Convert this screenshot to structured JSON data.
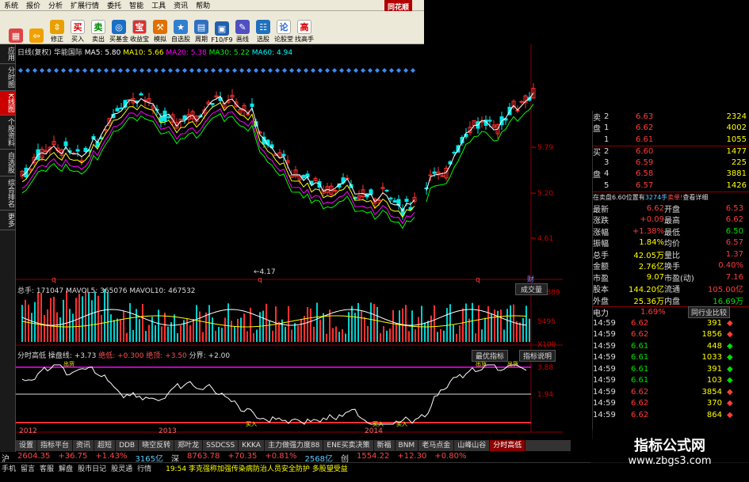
{
  "menu": [
    "系统",
    "报价",
    "分析",
    "扩展行情",
    "委托",
    "智能",
    "工具",
    "资讯",
    "帮助"
  ],
  "logo": "同花顺",
  "toolbar": [
    {
      "label": "",
      "icon": "grid-icon",
      "color": "#d44"
    },
    {
      "label": "",
      "icon": "back-arrow-icon",
      "color": "#f0a000"
    },
    {
      "label": "修正",
      "icon": "up-down-icon",
      "color": "#e8a000"
    },
    {
      "label": "买入",
      "text": "买",
      "color": "#fff",
      "tc": "#d00"
    },
    {
      "label": "卖出",
      "text": "卖",
      "color": "#fff",
      "tc": "#080"
    },
    {
      "label": "买基金",
      "icon": "fund-icon",
      "color": "#1a6fc4"
    },
    {
      "label": "收益宝",
      "text": "宝",
      "color": "#e03030",
      "tc": "#fff"
    },
    {
      "label": "模拟",
      "icon": "hammer-icon",
      "color": "#e07000"
    },
    {
      "label": "自选股",
      "icon": "star-icon",
      "color": "#3080d0"
    },
    {
      "label": "周期",
      "icon": "calendar-icon",
      "color": "#3070c0"
    },
    {
      "label": "F10/F9",
      "icon": "document-icon",
      "color": "#2060b0"
    },
    {
      "label": "画线",
      "icon": "pen-icon",
      "color": "#5050c0"
    },
    {
      "label": "选股",
      "icon": "pick-icon",
      "color": "#2070c0"
    },
    {
      "label": "论股堂",
      "text": "论",
      "color": "#fff",
      "tc": "#2a6ad0"
    },
    {
      "label": "找高手",
      "text": "高",
      "color": "#fff",
      "tc": "#d00"
    }
  ],
  "side_tabs": [
    "应用",
    "分时图",
    "K线图",
    "个股资料",
    "自选股",
    "综合排名",
    "更多"
  ],
  "kline": {
    "title": "日线(复权)",
    "stock": "华能国际",
    "ma": [
      {
        "t": "MA5: 5.80",
        "c": "#ffffff"
      },
      {
        "t": "MA10: 5.66",
        "c": "#ffff00"
      },
      {
        "t": "MA20: 5.38",
        "c": "#ff00ff"
      },
      {
        "t": "MA30: 5.22",
        "c": "#00ff00"
      },
      {
        "t": "MA60: 4.94",
        "c": "#00ffff"
      }
    ],
    "ticks": [
      "5.79",
      "5.20",
      "4.61"
    ],
    "low_label": "4.17",
    "markers": [
      "q",
      "q",
      "q",
      "q"
    ],
    "zoom_btn": "财"
  },
  "vol": {
    "header": "总手: 171047  MAVOL5: 365076  MAVOL10: 467532",
    "btn": "成交量",
    "ticks": [
      "10889",
      "5495",
      "X100"
    ]
  },
  "ind": {
    "header": "分时高低  操盘线: +3.73",
    "h2": "绝低: +0.300",
    "h3": "绝顶: +3.50",
    "h4": "分界: +2.00",
    "btn1": "最优指标",
    "btn2": "指标说明",
    "ticks": [
      "3.88",
      "1.94"
    ],
    "years": [
      "2012",
      "2013",
      "2014"
    ],
    "labels": [
      "出货",
      "出货",
      "出货",
      "买入",
      "买入",
      "买入"
    ]
  },
  "orders": [
    {
      "side": "卖",
      "n": "2",
      "p": "6.63",
      "v": "2324"
    },
    {
      "side": "盘",
      "n": "1",
      "p": "6.62",
      "v": "4002"
    },
    {
      "side": "",
      "n": "1",
      "p": "6.61",
      "v": "1055"
    },
    {
      "side": "买",
      "n": "2",
      "p": "6.60",
      "v": "1477"
    },
    {
      "side": "",
      "n": "3",
      "p": "6.59",
      "v": "225"
    },
    {
      "side": "盘",
      "n": "4",
      "p": "6.58",
      "v": "3881"
    },
    {
      "side": "",
      "n": "5",
      "p": "6.57",
      "v": "1426"
    }
  ],
  "notice": {
    "a": "在卖盘6.60位置有",
    "b": "3274手",
    "c": "卖单!",
    "d": "查看详细"
  },
  "quote": [
    {
      "l": "最新",
      "v": "6.62",
      "l2": "开盘",
      "v2": "6.53"
    },
    {
      "l": "涨跌",
      "v": "+0.09",
      "l2": "最高",
      "v2": "6.62"
    },
    {
      "l": "涨幅",
      "v": "+1.38%",
      "l2": "最低",
      "v2": "6.50"
    },
    {
      "l": "振幅",
      "v": "1.84%",
      "l2": "均价",
      "v2": "6.57"
    },
    {
      "l": "总手",
      "v": "42.05万",
      "l2": "量比",
      "v2": "1.37"
    },
    {
      "l": "金额",
      "v": "2.76亿",
      "l2": "换手",
      "v2": "0.40%"
    },
    {
      "l": "市盈",
      "v": "9.07",
      "l2": "市盈(动)",
      "v2": "7.16"
    },
    {
      "l": "股本",
      "v": "144.20亿",
      "l2": "流通",
      "v2": "105.00亿"
    },
    {
      "l": "外盘",
      "v": "25.36万",
      "l2": "内盘",
      "v2": "16.69万"
    }
  ],
  "industry": {
    "name": "电力",
    "pct": "1.69%",
    "btn": "同行业比较"
  },
  "ticks": [
    {
      "t": "14:59",
      "p": "6.62",
      "v": "391",
      "c": "red"
    },
    {
      "t": "14:59",
      "p": "6.62",
      "v": "1856",
      "c": "red"
    },
    {
      "t": "14:59",
      "p": "6.61",
      "v": "448",
      "c": "grn"
    },
    {
      "t": "14:59",
      "p": "6.61",
      "v": "1033",
      "c": "grn"
    },
    {
      "t": "14:59",
      "p": "6.61",
      "v": "391",
      "c": "grn"
    },
    {
      "t": "14:59",
      "p": "6.61",
      "v": "103",
      "c": "grn"
    },
    {
      "t": "14:59",
      "p": "6.62",
      "v": "3854",
      "c": "red"
    },
    {
      "t": "14:59",
      "p": "6.62",
      "v": "370",
      "c": "red"
    },
    {
      "t": "14:59",
      "p": "6.62",
      "v": "864",
      "c": "red"
    }
  ],
  "tabs": [
    "设置",
    "指标平台",
    "资讯",
    "超短",
    "DDB",
    "晓空反转",
    "郑叶龙",
    "SSDCSS",
    "KKKA",
    "主力做强力度88",
    "ENE买卖决策",
    "新福",
    "BNM",
    "老马点金",
    "山峰山谷",
    "分时高低"
  ],
  "status": {
    "sh": "沪",
    "sh_v": "2604.35",
    "sh_c": "+36.75",
    "sh_p": "+1.43%",
    "sh_a": "3165亿",
    "sz": "深",
    "sz_v": "8763.78",
    "sz_c": "+70.35",
    "sz_p": "+0.81%",
    "sz_a": "2568亿",
    "cy": "创",
    "cy_v": "1554.22",
    "cy_c": "+12.30",
    "cy_p": "+0.80%",
    "links": [
      "手机",
      "留言",
      "客服",
      "解盘",
      "股市日记",
      "股灵通",
      "行情"
    ],
    "news": "19:54 李克强称加强传染病防治人员安全防护 多股望受益"
  },
  "watermark": {
    "t": "指标公式网",
    "u": "www.zbgs3.com"
  }
}
